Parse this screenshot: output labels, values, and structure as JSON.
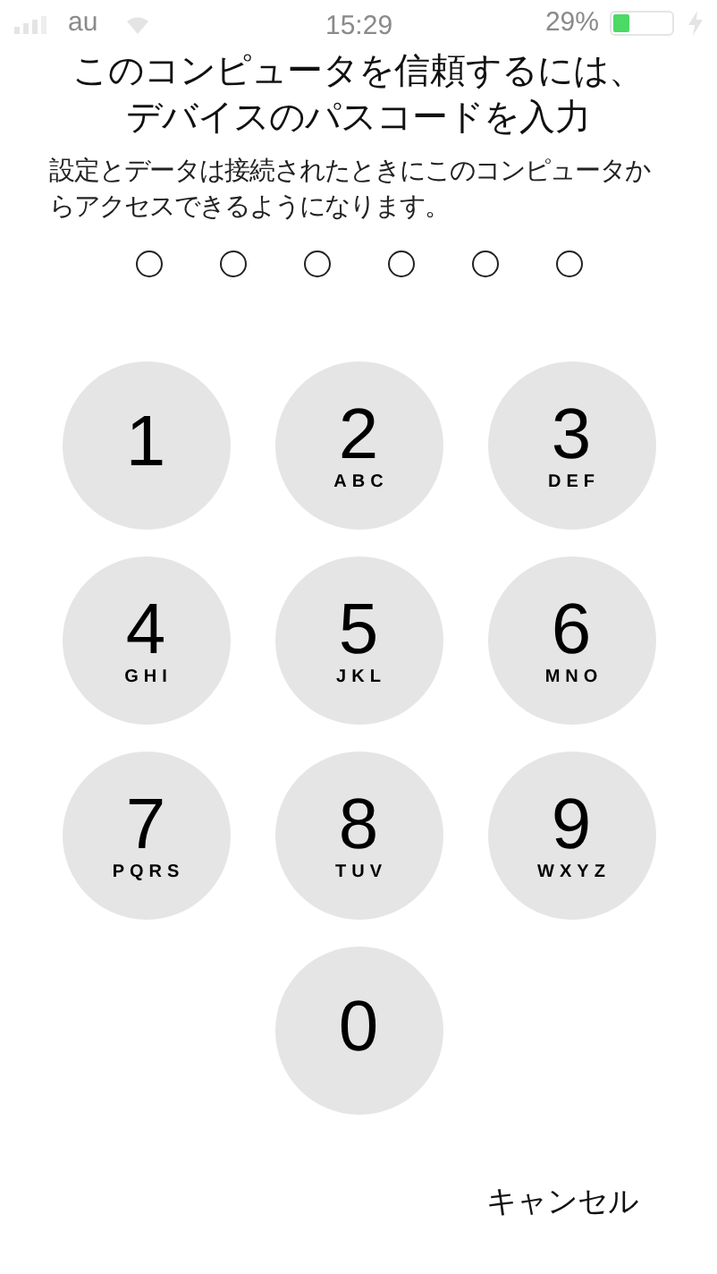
{
  "status_bar": {
    "carrier": "au",
    "time": "15:29",
    "battery_percent": "29%",
    "battery": {
      "level": 0.29,
      "charging": true
    }
  },
  "title": [
    "このコンピュータを信頼するには、",
    "デバイスのパスコードを入力"
  ],
  "message": "設定とデータは接続されたときにこのコンピュータからアクセスできるようになります。",
  "passcode_dots": [
    {
      "filled": false
    },
    {
      "filled": false
    },
    {
      "filled": false
    },
    {
      "filled": false
    },
    {
      "filled": false
    },
    {
      "filled": false
    }
  ],
  "keys": [
    {
      "digit": "1"
    },
    {
      "digit": "2",
      "letters": "ABC"
    },
    {
      "digit": "3",
      "letters": "DEF"
    },
    {
      "digit": "4",
      "letters": "GHI"
    },
    {
      "digit": "5",
      "letters": "JKL"
    },
    {
      "digit": "6",
      "letters": "MNO"
    },
    {
      "digit": "7",
      "letters": "PQRS"
    },
    {
      "digit": "8",
      "letters": "TUV"
    },
    {
      "digit": "9",
      "letters": "WXYZ"
    },
    {
      "digit": "0"
    }
  ],
  "cancel_button": "キャンセル"
}
